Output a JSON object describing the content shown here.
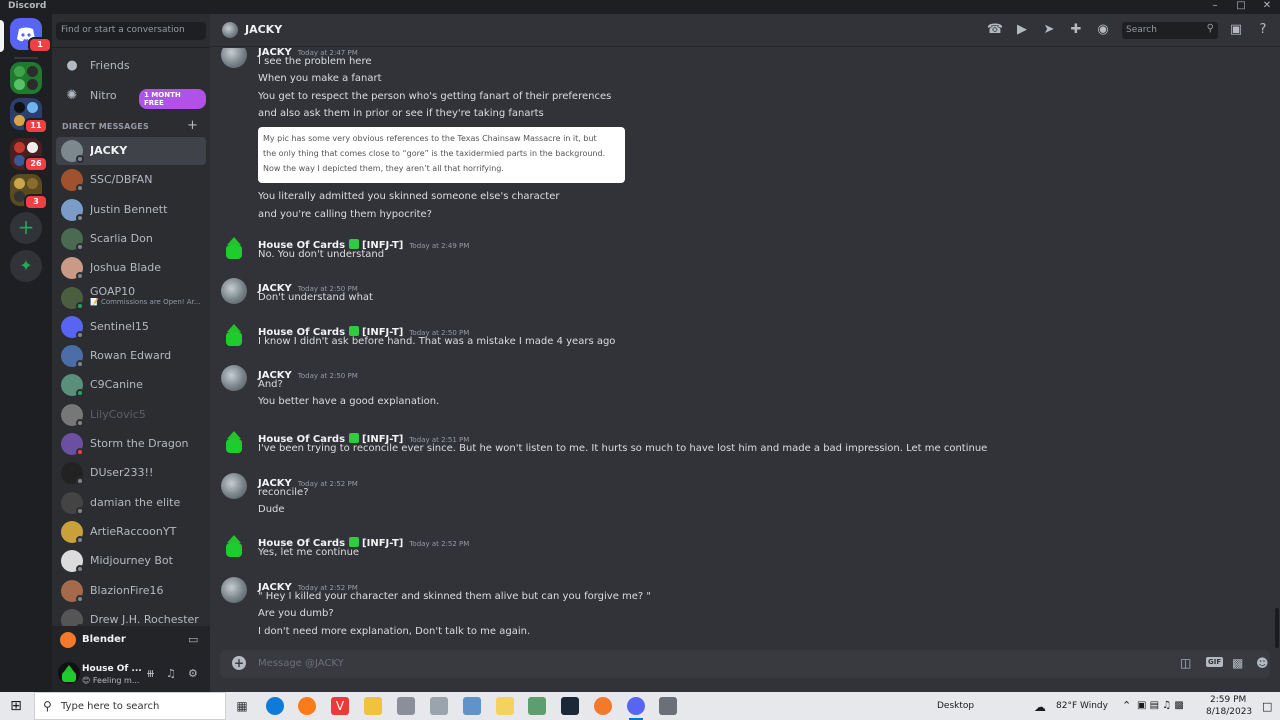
{
  "window": {
    "brand": "Discord"
  },
  "guilds": {
    "home_badge": "1",
    "badges": [
      "",
      "11",
      "26",
      "3"
    ]
  },
  "sidebar": {
    "search_placeholder": "Find or start a conversation",
    "friends_label": "Friends",
    "nitro_label": "Nitro",
    "nitro_badge": "1 MONTH FREE",
    "dm_header": "DIRECT MESSAGES",
    "add_dm": "+",
    "dms": [
      {
        "name": "JACKY",
        "active": true,
        "status": "offline"
      },
      {
        "name": "SSC/DBFAN",
        "status": "offline"
      },
      {
        "name": "Justin Bennett",
        "status": "offline"
      },
      {
        "name": "Scarlia Don",
        "status": "offline"
      },
      {
        "name": "Joshua Blade",
        "status": "offline"
      },
      {
        "name": "GOAP10",
        "sub": "📝 Commissions are Open! Ar...",
        "status": "online"
      },
      {
        "name": "Sentinel15",
        "status": "offline"
      },
      {
        "name": "Rowan Edward",
        "status": "offline"
      },
      {
        "name": "C9Canine",
        "status": "online"
      },
      {
        "name": "LilyCovic5",
        "status": "offline",
        "dim": true
      },
      {
        "name": "Storm the Dragon",
        "status": "dnd"
      },
      {
        "name": "DUser233!!",
        "status": "offline"
      },
      {
        "name": "damian the elite",
        "status": "offline"
      },
      {
        "name": "ArtieRaccoonYT",
        "status": "offline"
      },
      {
        "name": "Midjourney Bot",
        "status": "offline"
      },
      {
        "name": "BlazionFire16",
        "status": "offline"
      },
      {
        "name": "Drew J.H. Rochester",
        "status": "offline"
      }
    ],
    "activity_app": "Blender",
    "user": {
      "name": "House Of ...",
      "status": "😊 Feeling m..."
    }
  },
  "chat": {
    "title": "JACKY",
    "search_placeholder": "Search",
    "composer_placeholder": "Message @JACKY",
    "messages": [
      {
        "author": "JACKY",
        "avatar": "jacky",
        "time": "Today at 2:47 PM",
        "lines": [
          "I see the problem here",
          "When you make a fanart",
          "You get to respect the person who's getting fanart of their preferences",
          "and also ask them in prior or see if they're taking fanarts"
        ],
        "quote": [
          "My pic has some very obvious references to the Texas Chainsaw Massacre in it, but",
          "the only thing that comes close to “gore” is the taxidermied parts in the background.",
          "Now the way I depicted them, they aren’t all that horrifying."
        ],
        "after_quote": [
          "You literally admitted you skinned someone else's character",
          "and you're calling them hypocrite?"
        ]
      },
      {
        "author": "House Of Cards",
        "avatar": "hoc",
        "tag": "[INFJ-T]",
        "time": "Today at 2:49 PM",
        "lines": [
          "No. You don't understand"
        ]
      },
      {
        "author": "JACKY",
        "avatar": "jacky",
        "time": "Today at 2:50 PM",
        "lines": [
          "Don't understand what"
        ]
      },
      {
        "author": "House Of Cards",
        "avatar": "hoc",
        "tag": "[INFJ-T]",
        "time": "Today at 2:50 PM",
        "lines": [
          "I know I didn't ask before hand. That was a mistake I made 4 years ago"
        ]
      },
      {
        "author": "JACKY",
        "avatar": "jacky",
        "time": "Today at 2:50 PM",
        "lines": [
          "And?",
          "You better have a good explanation."
        ]
      },
      {
        "author": "House Of Cards",
        "avatar": "hoc",
        "tag": "[INFJ-T]",
        "time": "Today at 2:51 PM",
        "lines": [
          "I've been trying to reconcile ever since. But he won't listen to me. It hurts so much to have lost him and made a bad impression. Let me continue"
        ]
      },
      {
        "author": "JACKY",
        "avatar": "jacky",
        "time": "Today at 2:52 PM",
        "lines": [
          "reconcile?",
          "Dude"
        ]
      },
      {
        "author": "House Of Cards",
        "avatar": "hoc",
        "tag": "[INFJ-T]",
        "time": "Today at 2:52 PM",
        "lines": [
          "Yes, let me continue"
        ]
      },
      {
        "author": "JACKY",
        "avatar": "jacky",
        "time": "Today at 2:52 PM",
        "lines": [
          "\" Hey I killed your character and skinned them alive but can you forgive me? \"",
          "Are you dumb?",
          "I don't need more explanation, Don't talk to me again."
        ]
      }
    ]
  },
  "taskbar": {
    "search_placeholder": "Type here to search",
    "desktop_label": "Desktop",
    "weather": "82°F  Windy",
    "time": "2:59 PM",
    "date": "8/18/2023"
  }
}
